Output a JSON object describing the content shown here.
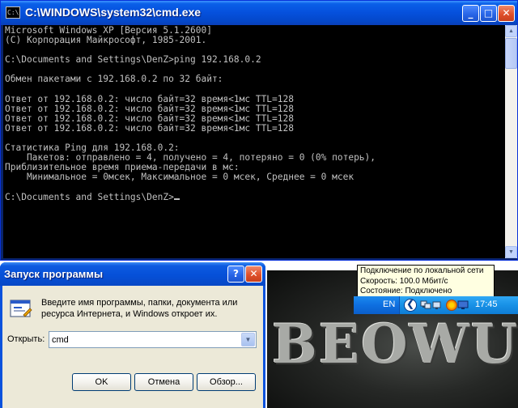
{
  "cmd": {
    "title": "C:\\WINDOWS\\system32\\cmd.exe",
    "icon_label": "C:\\",
    "minimize_glyph": "_",
    "maximize_glyph": "□",
    "close_glyph": "✕",
    "console_text": "Microsoft Windows XP [Версия 5.1.2600]\n(С) Корпорация Майкрософт, 1985-2001.\n\nC:\\Documents and Settings\\DenZ>ping 192.168.0.2\n\nОбмен пакетами с 192.168.0.2 по 32 байт:\n\nОтвет от 192.168.0.2: число байт=32 время<1мс TTL=128\nОтвет от 192.168.0.2: число байт=32 время<1мс TTL=128\nОтвет от 192.168.0.2: число байт=32 время<1мс TTL=128\nОтвет от 192.168.0.2: число байт=32 время<1мс TTL=128\n\nСтатистика Ping для 192.168.0.2:\n    Пакетов: отправлено = 4, получено = 4, потеряно = 0 (0% потерь),\nПриблизительное время приема-передачи в мс:\n    Минимальное = 0мсек, Максимальное = 0 мсек, Среднее = 0 мсек\n\nC:\\Documents and Settings\\DenZ>",
    "console_fg": "#c0c0c0",
    "console_bg": "#000000"
  },
  "tooltip": {
    "line1": "Подключение по локальной сети",
    "line2": "Скорость: 100.0 Мбит/с",
    "line3": "Состояние: Подключено"
  },
  "tray": {
    "language": "EN",
    "arrow_glyph": "❮",
    "clock": "17:45"
  },
  "poster": {
    "text": "BEOWU"
  },
  "run": {
    "title": "Запуск программы",
    "help_glyph": "?",
    "close_glyph": "✕",
    "description": "Введите имя программы, папки, документа или ресурса Интернета, и Windows откроет их.",
    "open_label": "Открыть:",
    "input_value": "cmd",
    "ok_label": "OK",
    "cancel_label": "Отмена",
    "browse_label": "Обзор..."
  },
  "colors": {
    "xp_title_blue": "#0550dc",
    "dialog_face": "#ece9d8",
    "tooltip_bg": "#ffffe1"
  }
}
